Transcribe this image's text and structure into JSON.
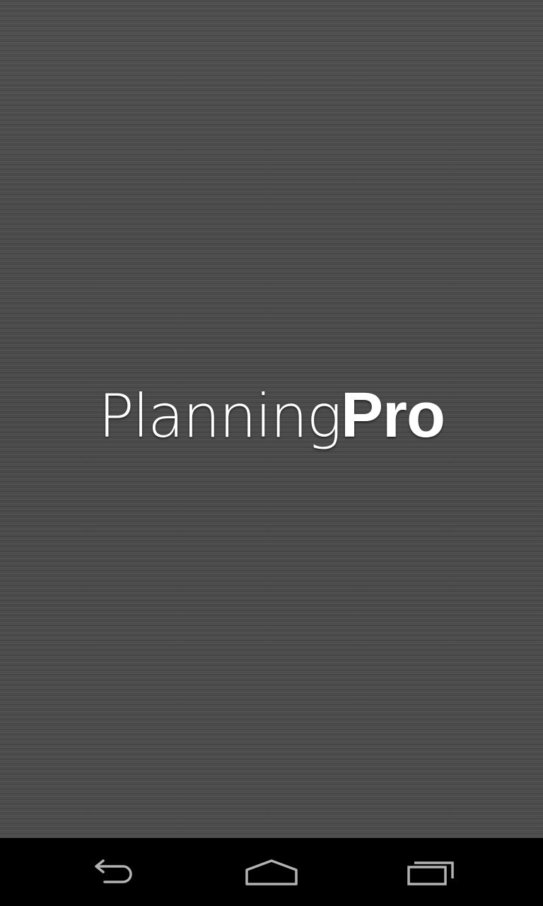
{
  "app": {
    "logo_light": "Planning",
    "logo_bold": "Pro"
  },
  "navigation_bar": {
    "back_icon": "back-arrow-icon",
    "home_icon": "home-icon",
    "recents_icon": "recent-apps-icon"
  },
  "colors": {
    "splash_background": "#4a4a4a",
    "logo_text": "#ffffff",
    "navbar_background": "#000000",
    "nav_icon": "#b3b3b3"
  }
}
